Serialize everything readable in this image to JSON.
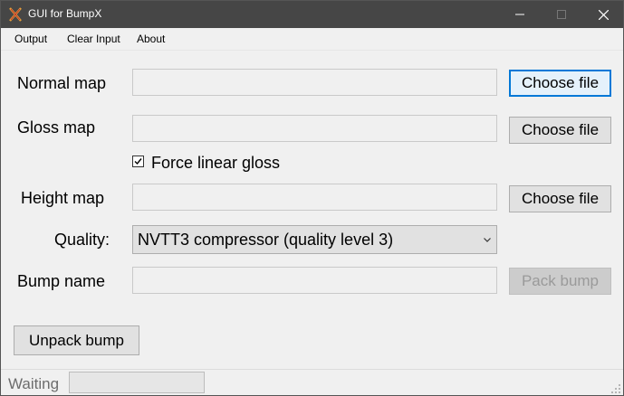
{
  "window": {
    "title": "GUI for BumpX"
  },
  "menu": [
    "Output",
    "Clear Input",
    "About"
  ],
  "form": {
    "normal_map_label": "Normal map",
    "gloss_map_label": "Gloss map",
    "height_map_label": "Height map",
    "quality_label": "Quality:",
    "bump_name_label": "Bump name",
    "choose_file": "Choose file",
    "force_linear_gloss": "Force linear gloss",
    "force_linear_gloss_checked": true,
    "quality_value": "NVTT3 compressor (quality level 3)",
    "pack_bump": "Pack bump",
    "unpack_bump": "Unpack bump",
    "normal_map_value": "",
    "gloss_map_value": "",
    "height_map_value": "",
    "bump_name_value": ""
  },
  "status": {
    "text": "Waiting",
    "progress": 0
  },
  "colors": {
    "titlebar": "#464646",
    "focus": "#0078d7",
    "progress_fill": "#06b025"
  },
  "icons": {
    "app": "bumpx-app-icon",
    "minimize": "minimize-icon",
    "maximize": "maximize-icon",
    "close": "close-icon",
    "check": "check-icon",
    "dropdown": "chevron-down-icon",
    "grip": "resize-grip-icon"
  }
}
